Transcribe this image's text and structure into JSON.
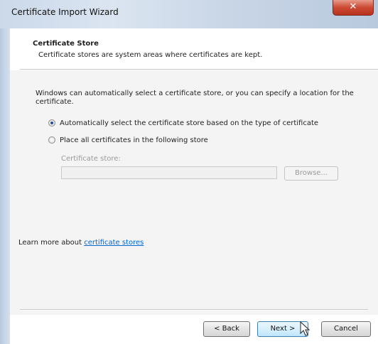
{
  "window": {
    "title": "Certificate Import Wizard",
    "close_glyph": "✕"
  },
  "header": {
    "title": "Certificate Store",
    "subtitle": "Certificate stores are system areas where certificates are kept."
  },
  "body": {
    "intro": "Windows can automatically select a certificate store, or you can specify a location for the certificate.",
    "options": [
      {
        "label": "Automatically select the certificate store based on the type of certificate",
        "checked": true
      },
      {
        "label": "Place all certificates in the following store",
        "checked": false
      }
    ],
    "store_label": "Certificate store:",
    "store_value": "",
    "browse_label": "Browse..."
  },
  "learn_more": {
    "prefix": "Learn more about ",
    "link": "certificate stores"
  },
  "buttons": {
    "back": "< Back",
    "next": "Next >",
    "cancel": "Cancel"
  },
  "colors": {
    "link": "#0066cc",
    "close": "#c7402a",
    "accent": "#3c7fb1"
  }
}
